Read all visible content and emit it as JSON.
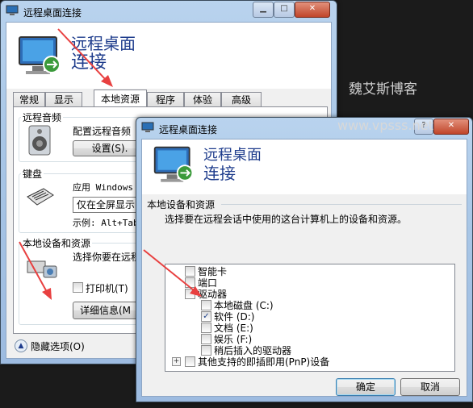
{
  "back_window": {
    "title": "远程桌面连接",
    "banner_line1": "远程桌面",
    "banner_line2": "连接",
    "tabs": [
      {
        "label": "常规"
      },
      {
        "label": "显示"
      },
      {
        "label": "本地资源"
      },
      {
        "label": "程序"
      },
      {
        "label": "体验"
      },
      {
        "label": "高级"
      }
    ],
    "audio_group": {
      "title": "远程音频",
      "desc": "配置远程音频",
      "settings_button": "设置(S)."
    },
    "keyboard_group": {
      "title": "键盘",
      "desc": "应用 Windows",
      "dropdown_value": "仅在全屏显示",
      "example": "示例: Alt+Tab"
    },
    "devices_group": {
      "title": "本地设备和资源",
      "desc": "选择你要在远程",
      "printer_label": "打印机(T)",
      "details_button": "详细信息(M"
    },
    "hide_options": "隐藏选项(O)"
  },
  "watermark": {
    "brand": "魏艾斯博客",
    "url": "www.vpsss.net"
  },
  "front_window": {
    "title": "远程桌面连接",
    "banner_line1": "远程桌面",
    "banner_line2": "连接",
    "section_title": "本地设备和资源",
    "instruction": "选择要在远程会话中使用的这台计算机上的设备和资源。",
    "tree": [
      {
        "label": "智能卡",
        "checked": false
      },
      {
        "label": "端口",
        "checked": false
      },
      {
        "label": "驱动器",
        "checked": false
      },
      {
        "label": "本地磁盘 (C:)",
        "checked": false
      },
      {
        "label": "软件 (D:)",
        "checked": true
      },
      {
        "label": "文档 (E:)",
        "checked": false
      },
      {
        "label": "娱乐 (F:)",
        "checked": false
      },
      {
        "label": "稍后插入的驱动器",
        "checked": false
      },
      {
        "label": "其他支持的即插即用(PnP)设备",
        "checked": false
      }
    ],
    "expand_symbol": "+",
    "ok_button": "确定",
    "cancel_button": "取消"
  },
  "colors": {
    "accent": "#1e3c8c",
    "arrow": "#e84040"
  },
  "icons": [
    "rdp-icon",
    "speaker-icon",
    "keyboard-icon",
    "devices-icon",
    "chevron-up-icon",
    "minimize-icon",
    "maximize-icon",
    "close-icon",
    "help-icon"
  ]
}
